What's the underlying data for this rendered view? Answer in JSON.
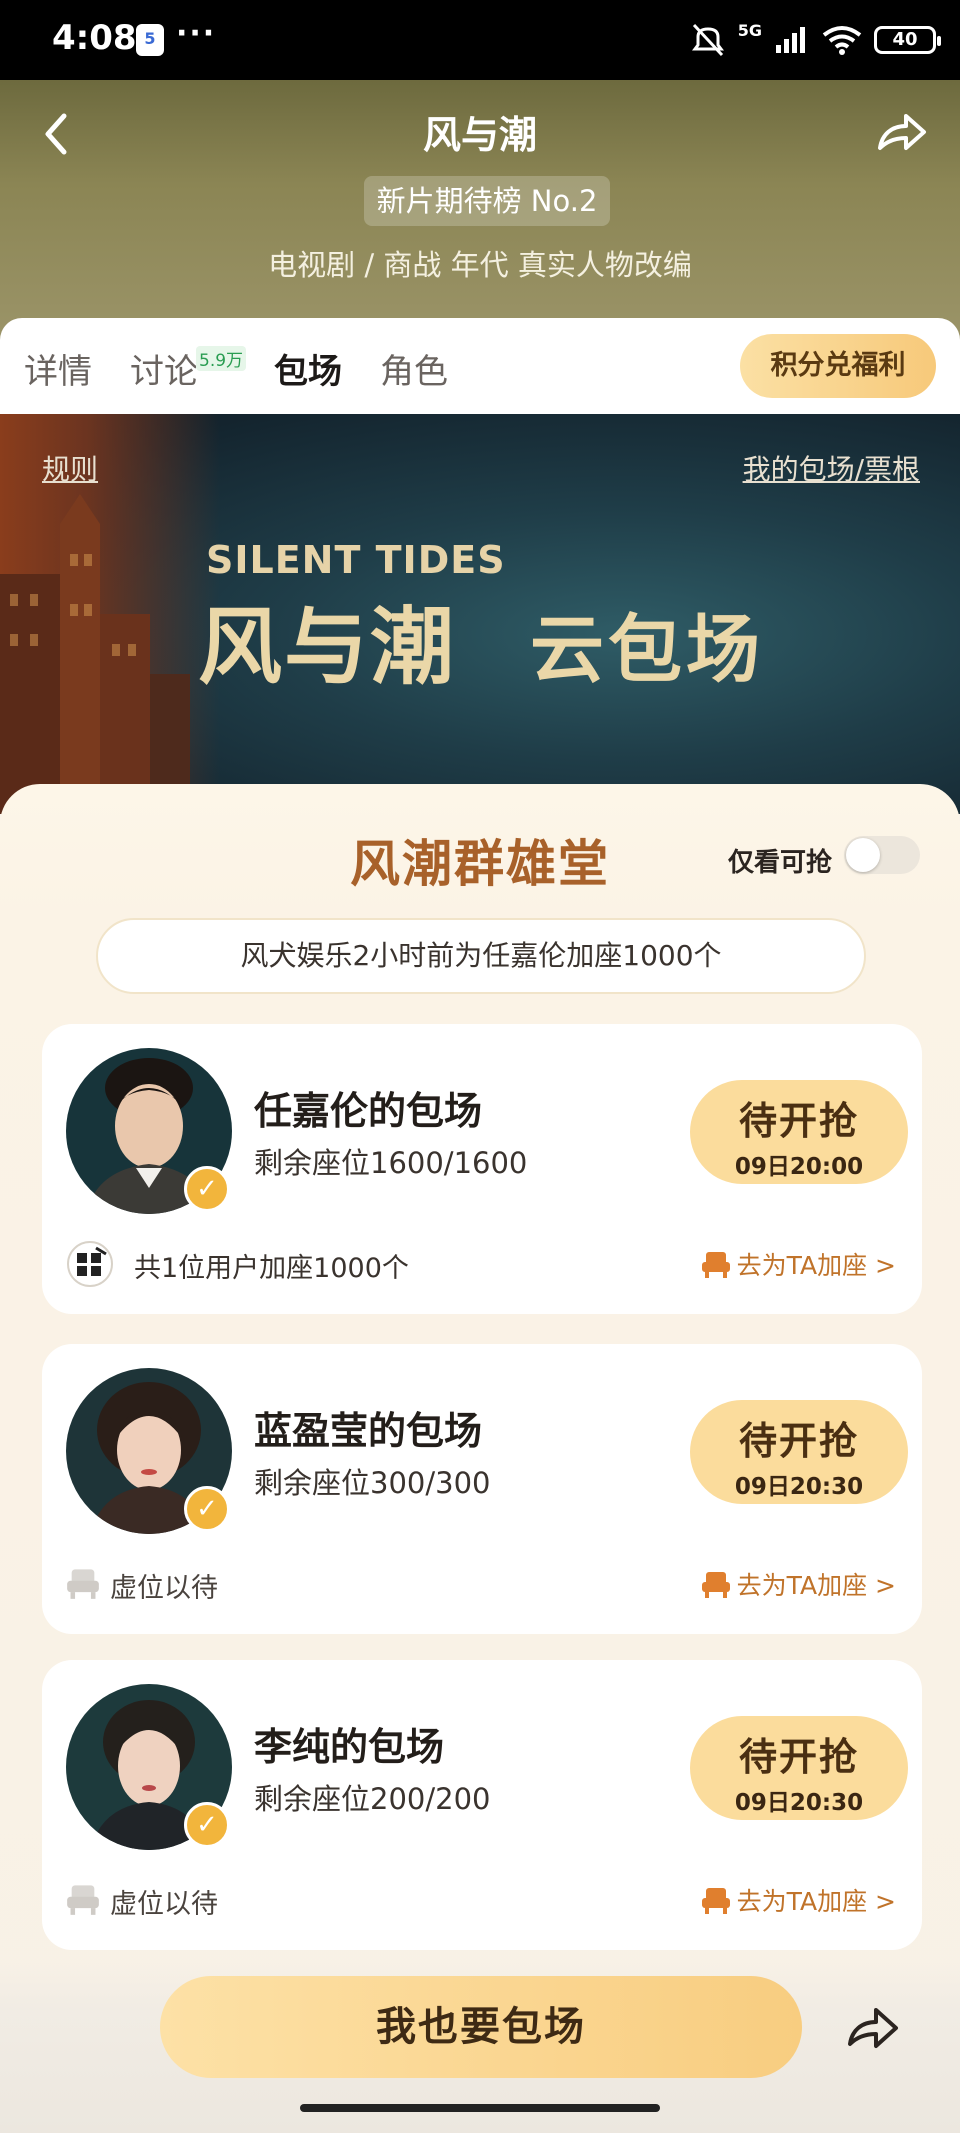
{
  "status_bar": {
    "time": "4:08",
    "notification_badge": "5",
    "more": "···",
    "network": "5G",
    "battery": "40"
  },
  "header": {
    "title": "风与潮",
    "rank_badge": "新片期待榜 No.2",
    "genre": "电视剧 / 商战 年代 真实人物改编"
  },
  "tabs": [
    {
      "label": "详情",
      "active": false
    },
    {
      "label": "讨论",
      "count": "5.9万",
      "active": false
    },
    {
      "label": "包场",
      "active": true
    },
    {
      "label": "角色",
      "active": false
    }
  ],
  "points_button": "积分兑福利",
  "banner": {
    "rules_link": "规则",
    "my_link": "我的包场/票根",
    "title_en": "SILENT TIDES",
    "title_cn": "风与潮",
    "subtitle": "云包场"
  },
  "hall": {
    "title": "风潮群雄堂",
    "filter_label": "仅看可抢",
    "filter_on": false,
    "notice": "风犬娱乐2小时前为任嘉伦加座1000个"
  },
  "cards": [
    {
      "name": "任嘉伦的包场",
      "seats": "剩余座位1600/1600",
      "button_label": "待开抢",
      "button_time": "09日20:00",
      "footer_text": "共1位用户加座1000个",
      "footer_icon": "fengquan-logo-icon",
      "add_link": "去为TA加座 >"
    },
    {
      "name": "蓝盈莹的包场",
      "seats": "剩余座位300/300",
      "button_label": "待开抢",
      "button_time": "09日20:30",
      "footer_text": "虚位以待",
      "footer_icon": "empty-seat-icon",
      "add_link": "去为TA加座 >"
    },
    {
      "name": "李纯的包场",
      "seats": "剩余座位200/200",
      "button_label": "待开抢",
      "button_time": "09日20:30",
      "footer_text": "虚位以待",
      "footer_icon": "empty-seat-icon",
      "add_link": "去为TA加座 >"
    }
  ],
  "cta": "我也要包场",
  "colors": {
    "accent_gold": "#f8cd80",
    "hall_title": "#a8612a",
    "link_orange": "#c0732a",
    "header_olive": "#8b8554"
  }
}
